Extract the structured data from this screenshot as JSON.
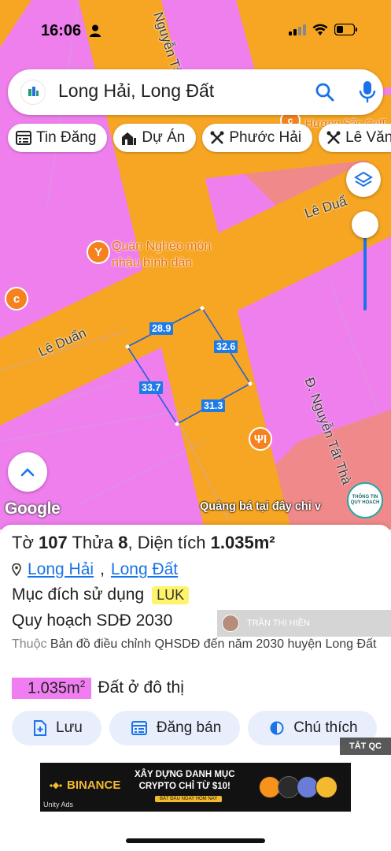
{
  "status": {
    "time": "16:06"
  },
  "search": {
    "query": "Long Hải, Long Đất"
  },
  "chips": [
    {
      "label": "Tin Đăng",
      "icon": "calendar-list-icon"
    },
    {
      "label": "Dự Án",
      "icon": "building-icon"
    },
    {
      "label": "Phước Hải",
      "icon": "tools-icon"
    },
    {
      "label": "Lê Văn",
      "icon": "tools-icon"
    }
  ],
  "map": {
    "streets": {
      "le_duan_left": "Lê Duẩn",
      "le_duan_right": "Lê Duẩ",
      "nguyen_tat_thanh_top": "Nguyễn Tất T",
      "nguyen_tat_thanh_right": "Đ. Nguyễn Tất Thà",
      "huong_sac": "Hương Sắc Coff"
    },
    "poi": {
      "name_line1": "Quán Nghèo món",
      "name_line2": "nhậu bình dân"
    },
    "dimensions": {
      "top": "28.9",
      "right": "32.6",
      "left": "33.7",
      "bottom": "31.3"
    },
    "google_logo": "Google",
    "ad_text": "Quảng bá tại đây chỉ v",
    "info_badge_line1": "THÔNG TIN",
    "info_badge_line2": "QUY HOẠCH"
  },
  "parcel": {
    "to_label": "Tờ",
    "to_value": "107",
    "thua_label": "Thửa",
    "thua_value": "8",
    "area_label": "Diện tích",
    "area_value": "1.035m²",
    "ward": "Long Hải",
    "district": "Long Đất",
    "purpose_label": "Mục đích sử dụng",
    "purpose_code": "LUK",
    "plan_label": "Quy hoạch SDĐ 2030",
    "thuoc_label": "Thuộc",
    "thuoc_text": "Bản đồ điều chỉnh QHSDĐ đến năm 2030 huyện Long Đất",
    "area_badge": "1.035m",
    "area_badge_sup": "2",
    "land_type": "Đất ở đô thị",
    "watermark_name": "TRẦN THỊ HIỀN"
  },
  "actions": [
    {
      "label": "Lưu",
      "icon": "save-icon"
    },
    {
      "label": "Đăng bán",
      "icon": "listing-icon"
    },
    {
      "label": "Chú thích",
      "icon": "contrast-icon"
    }
  ],
  "ad": {
    "brand": "BINANCE",
    "headline_line1": "XÂY DỰNG DANH MỤC",
    "headline_line2": "CRYPTO CHỈ TỪ $10!",
    "cta": "BẮT ĐẦU NGAY HÔM NAY",
    "network": "Unity Ads",
    "close_label": "TẮT QC"
  },
  "colors": {
    "residential_pink": "#ef7fed",
    "road_orange": "#f6a623",
    "accent_blue": "#1a73e8",
    "luk_yellow": "#fff36b"
  }
}
